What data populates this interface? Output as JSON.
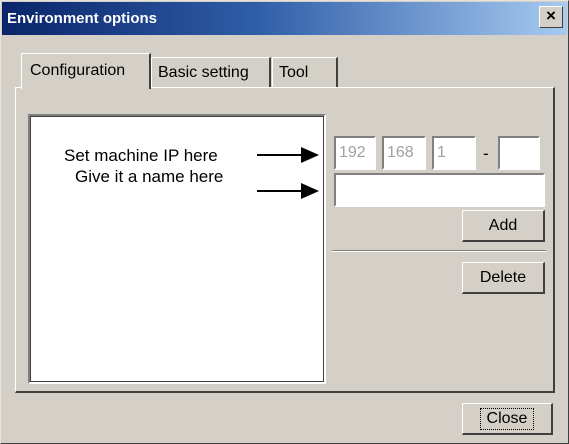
{
  "window": {
    "title": "Environment options",
    "close_glyph": "×"
  },
  "tabs": [
    {
      "label": "Configuration",
      "selected": true
    },
    {
      "label": "Basic setting",
      "selected": false
    },
    {
      "label": "Tool",
      "selected": false
    }
  ],
  "config": {
    "annotation_ip": "Set machine IP here",
    "annotation_name": "Give it a name here",
    "ip": {
      "octet1": "192",
      "octet2": "168",
      "octet3": "1",
      "separator": "-",
      "octet4": ""
    },
    "name_value": "",
    "add_label": "Add",
    "delete_label": "Delete"
  },
  "footer": {
    "close_label": "Close"
  },
  "colors": {
    "face": "#d4d0c8",
    "title_start": "#0a246a",
    "title_end": "#a6caf0"
  },
  "icons": [
    "close-icon",
    "arrow-right-icon"
  ]
}
